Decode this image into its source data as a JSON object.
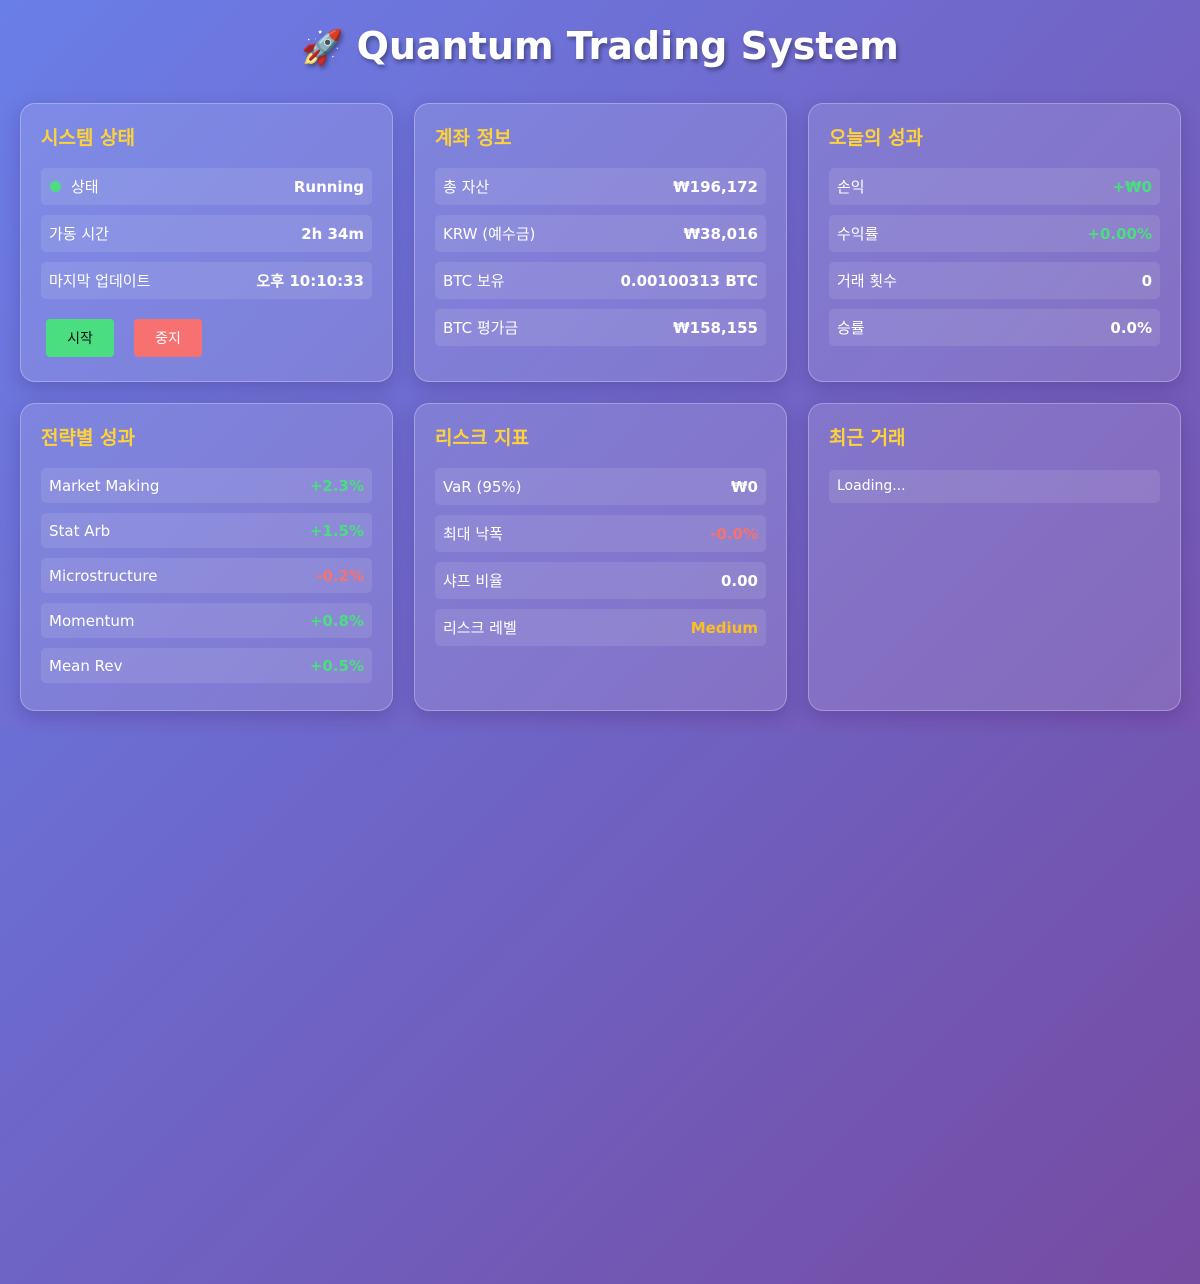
{
  "title": {
    "icon": "🚀",
    "text": "Quantum Trading System"
  },
  "colors": {
    "heading": "#ffd23a",
    "positive": "#4ade80",
    "negative": "#f87171",
    "warning": "#fbbf24"
  },
  "system_status": {
    "title": "시스템 상태",
    "status_label": "상태",
    "status_value": "Running",
    "uptime_label": "가동 시간",
    "uptime_value": "2h 34m",
    "updated_label": "마지막 업데이트",
    "updated_value": "오후 10:10:33",
    "start_label": "시작",
    "stop_label": "중지"
  },
  "account": {
    "title": "계좌 정보",
    "rows": [
      {
        "label": "총 자산",
        "value": "₩196,172"
      },
      {
        "label": "KRW (예수금)",
        "value": "₩38,016"
      },
      {
        "label": "BTC 보유",
        "value": "0.00100313 BTC"
      },
      {
        "label": "BTC 평가금",
        "value": "₩158,155"
      }
    ]
  },
  "today": {
    "title": "오늘의 성과",
    "rows": [
      {
        "label": "손익",
        "value": "+₩0"
      },
      {
        "label": "수익률",
        "value": "+0.00%"
      },
      {
        "label": "거래 횟수",
        "value": "0"
      },
      {
        "label": "승률",
        "value": "0.0%"
      }
    ]
  },
  "strategies": {
    "title": "전략별 성과",
    "rows": [
      {
        "label": "Market Making",
        "value": "+2.3%"
      },
      {
        "label": "Stat Arb",
        "value": "+1.5%"
      },
      {
        "label": "Microstructure",
        "value": "-0.2%"
      },
      {
        "label": "Momentum",
        "value": "+0.8%"
      },
      {
        "label": "Mean Rev",
        "value": "+0.5%"
      }
    ]
  },
  "risk": {
    "title": "리스크 지표",
    "rows": [
      {
        "label": "VaR (95%)",
        "value": "₩0"
      },
      {
        "label": "최대 낙폭",
        "value": "-0.0%"
      },
      {
        "label": "샤프 비율",
        "value": "0.00"
      },
      {
        "label": "리스크 레벨",
        "value": "Medium"
      }
    ]
  },
  "recent_trades": {
    "title": "최근 거래",
    "loading": "Loading..."
  }
}
